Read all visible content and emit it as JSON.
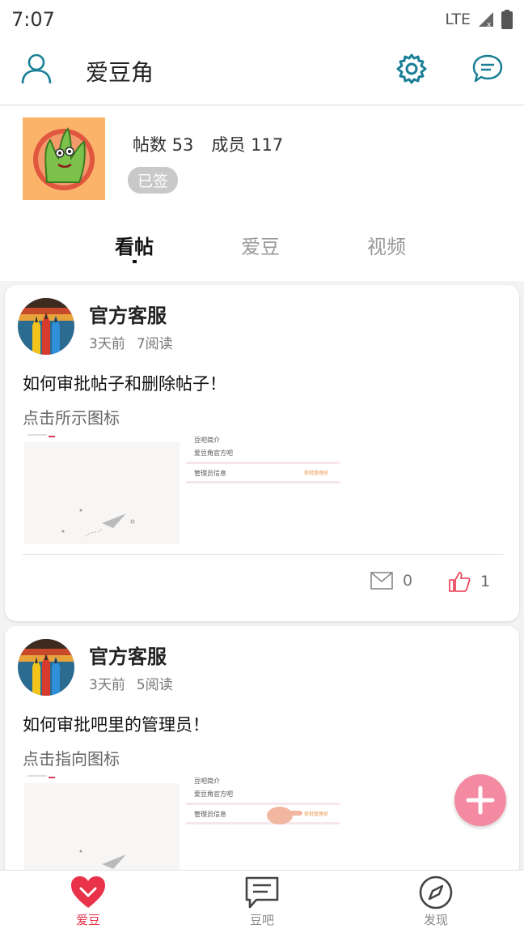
{
  "status_bar": {
    "time": "7:07",
    "network": "LTE"
  },
  "app_bar": {
    "title": "爱豆角"
  },
  "group": {
    "posts_label": "帖数 53",
    "members_label": "成员 117",
    "signed_badge": "已签"
  },
  "tabs": [
    {
      "label": "看帖",
      "active": true
    },
    {
      "label": "爱豆",
      "active": false
    },
    {
      "label": "视频",
      "active": false
    }
  ],
  "posts": [
    {
      "author": "官方客服",
      "time": "3天前",
      "reads": "7阅读",
      "title": "如何审批帖子和删除帖子！",
      "desc": "点击所示图标",
      "thumb_lines": [
        "豆吧简介",
        "爱豆角官方吧",
        "管理员信息",
        "审批管理员"
      ],
      "comments": "0",
      "likes": "1"
    },
    {
      "author": "官方客服",
      "time": "3天前",
      "reads": "5阅读",
      "title": "如何审批吧里的管理员！",
      "desc": "点击指向图标",
      "thumb_lines": [
        "豆吧简介",
        "爱豆角官方吧",
        "管理员信息",
        "审批管理员"
      ]
    }
  ],
  "bottom_nav": [
    {
      "label": "爱豆",
      "icon": "heart-icon",
      "active": true
    },
    {
      "label": "豆吧",
      "icon": "chat-icon",
      "active": false
    },
    {
      "label": "发现",
      "icon": "compass-icon",
      "active": false
    }
  ],
  "colors": {
    "accent": "#e8334a",
    "teal": "#1a7f96",
    "fab": "#f48aa1"
  }
}
